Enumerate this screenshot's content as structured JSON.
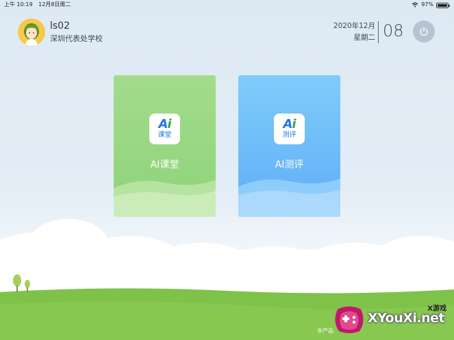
{
  "status_bar": {
    "time": "上午 10:19",
    "date": "12月8日周二",
    "battery": "97%",
    "battery_level": 0.97
  },
  "user": {
    "name": "ls02",
    "school": "深圳代表处学校"
  },
  "date_panel": {
    "year_month": "2020年12月",
    "weekday": "星期二",
    "day": "08"
  },
  "cards": [
    {
      "icon_mark_a": "A",
      "icon_mark_i": "i",
      "icon_sub": "课堂",
      "label": "AI课堂"
    },
    {
      "icon_mark_a": "A",
      "icon_mark_i": "i",
      "icon_sub": "测评",
      "label": "AI测评"
    }
  ],
  "footer": {
    "text": "本产品"
  },
  "watermark": {
    "text": "XYouXi.net",
    "sub": "X游戏"
  },
  "colors": {
    "classroom_card": "#8ed27a",
    "assessment_card": "#5faef6",
    "grass": "#7fc24a",
    "sky": "#dde9f3"
  }
}
